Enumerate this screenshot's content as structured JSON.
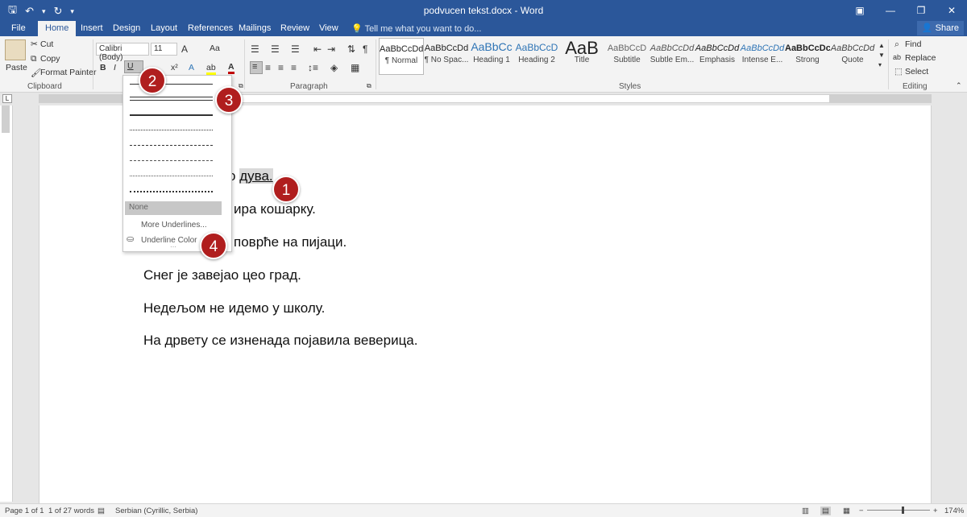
{
  "window": {
    "title": "podvucen tekst.docx - Word",
    "minimize": "—",
    "restore": "❐",
    "close": "✕",
    "ribbon_display": "▣"
  },
  "qat": {
    "save": "🖫",
    "undo": "↶",
    "undo_arrow": "▾",
    "redo": "↻",
    "customize": "▾"
  },
  "tabs": [
    {
      "label": "File"
    },
    {
      "label": "Home"
    },
    {
      "label": "Insert"
    },
    {
      "label": "Design"
    },
    {
      "label": "Layout"
    },
    {
      "label": "References"
    },
    {
      "label": "Mailings"
    },
    {
      "label": "Review"
    },
    {
      "label": "View"
    }
  ],
  "tell_me": "Tell me what you want to do...",
  "share": "Share",
  "clipboard": {
    "paste": "Paste",
    "cut": "Cut",
    "copy": "Copy",
    "format_painter": "Format Painter",
    "label": "Clipboard"
  },
  "font": {
    "name": "Calibri (Body)",
    "size": "11",
    "bold": "B",
    "italic": "I",
    "underline": "U",
    "superscript": "x²",
    "change_case": "Aa",
    "grow": "A",
    "font_color": "A"
  },
  "paragraph": {
    "label": "Paragraph",
    "pilcrow": "¶"
  },
  "styles": {
    "label": "Styles",
    "items": [
      {
        "preview": "AaBbCcDd",
        "name": "¶ Normal"
      },
      {
        "preview": "AaBbCcDd",
        "name": "¶ No Spac..."
      },
      {
        "preview": "AaBbCc",
        "name": "Heading 1"
      },
      {
        "preview": "AaBbCcD",
        "name": "Heading 2"
      },
      {
        "preview": "AaB",
        "name": "Title"
      },
      {
        "preview": "AaBbCcD",
        "name": "Subtitle"
      },
      {
        "preview": "AaBbCcDd",
        "name": "Subtle Em..."
      },
      {
        "preview": "AaBbCcDd",
        "name": "Emphasis"
      },
      {
        "preview": "AaBbCcDd",
        "name": "Intense E..."
      },
      {
        "preview": "AaBbCcDc",
        "name": "Strong"
      },
      {
        "preview": "AaBbCcDd",
        "name": "Quote"
      }
    ]
  },
  "editing": {
    "find": "Find",
    "replace": "Replace",
    "select": "Select",
    "label": "Editing"
  },
  "document": {
    "lines": [
      {
        "before": "о ",
        "highlight": "дува.",
        "after": ""
      },
      {
        "before": "ира кошарку.",
        "highlight": "",
        "after": ""
      },
      {
        "before": "поврће на пијаци.",
        "highlight": "",
        "after": ""
      },
      {
        "before": "Снег је завејао цео град.",
        "highlight": "",
        "after": ""
      },
      {
        "before": "Недељом не идемо у школу.",
        "highlight": "",
        "after": ""
      },
      {
        "before": "На дрвету се изненада појавила веверица.",
        "highlight": "",
        "after": ""
      }
    ]
  },
  "underline_menu": {
    "none": "None",
    "more": "More Underlines...",
    "color": "Underline Color"
  },
  "callouts": [
    "1",
    "2",
    "3",
    "4"
  ],
  "status": {
    "page": "Page 1 of 1",
    "words": "1 of 27 words",
    "language": "Serbian (Cyrillic, Serbia)",
    "zoom": "174%"
  }
}
